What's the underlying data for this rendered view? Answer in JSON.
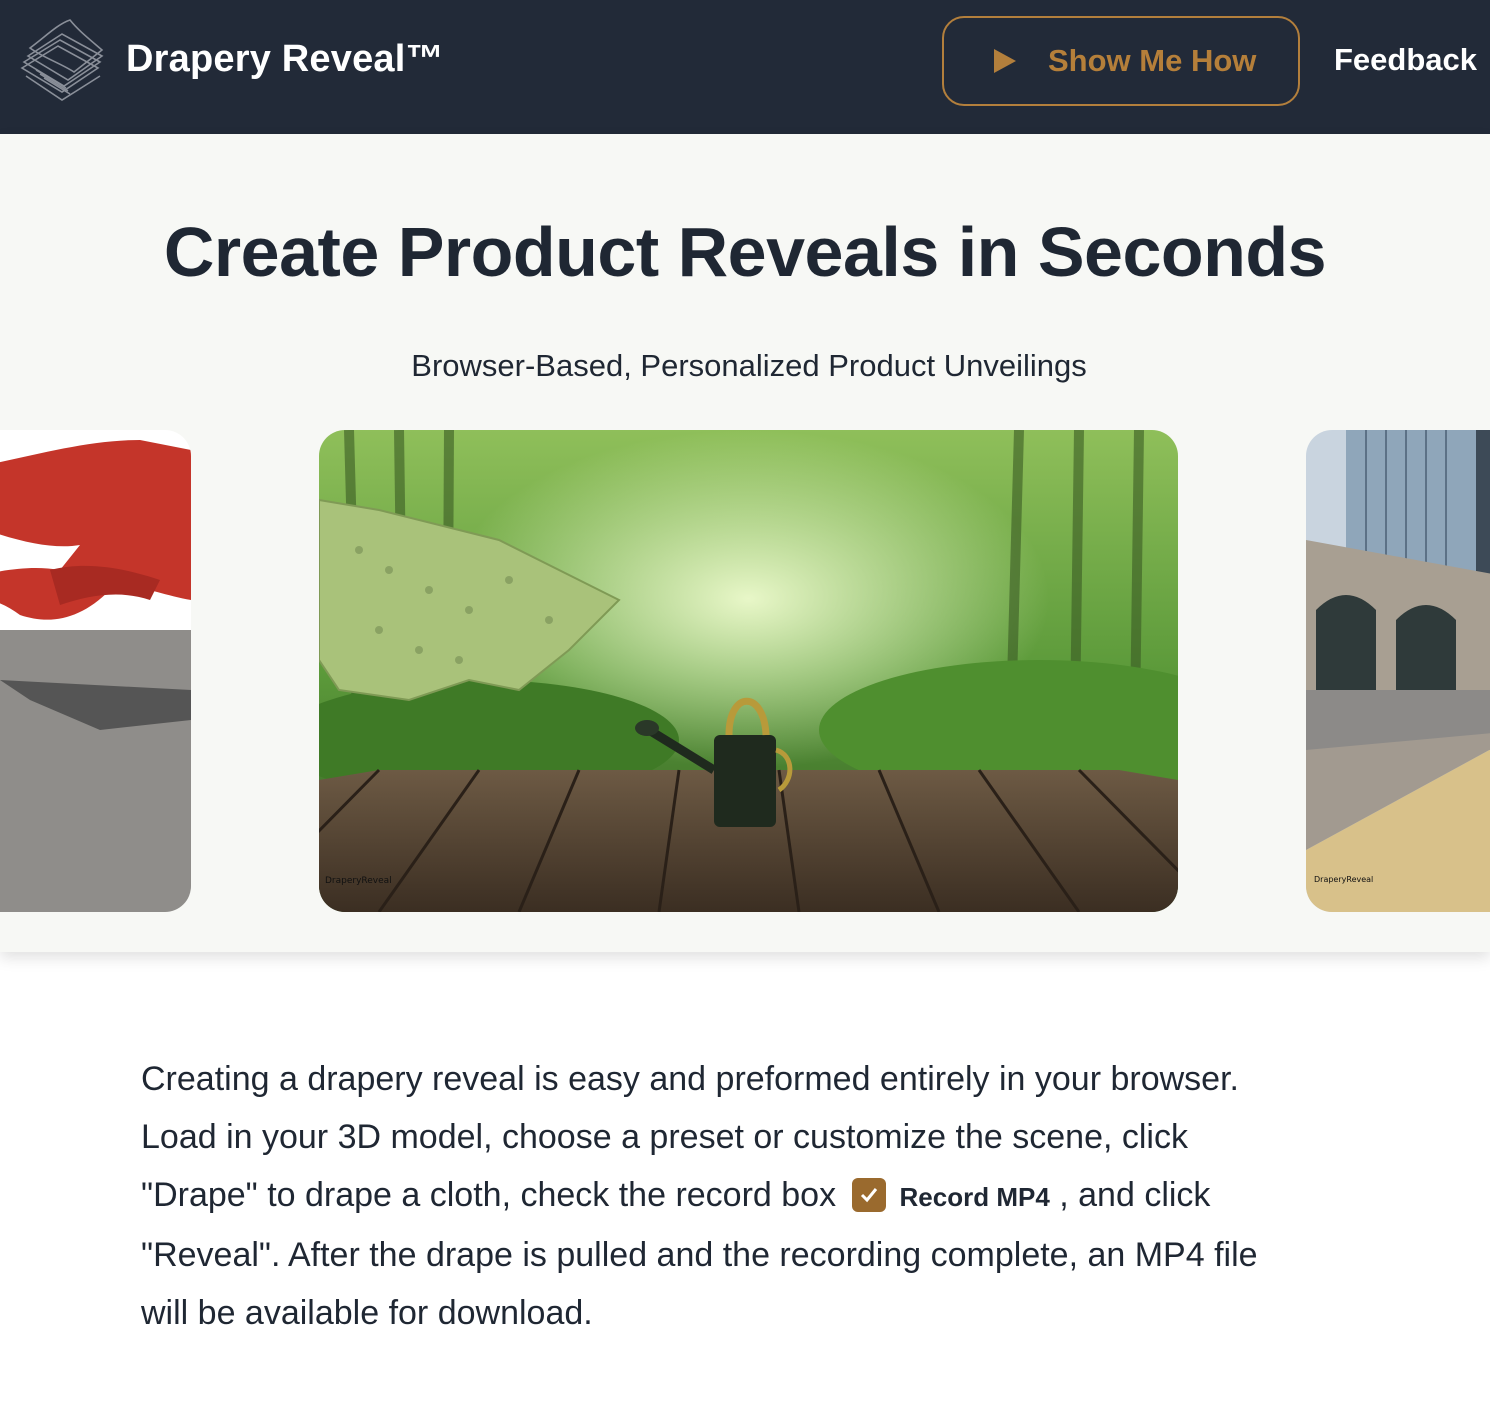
{
  "header": {
    "brand": "Drapery Reveal™",
    "show_me_how": "Show Me How",
    "feedback": "Feedback"
  },
  "hero": {
    "title": "Create Product Reveals in Seconds",
    "subtitle": "Browser-Based, Personalized Product Unveilings",
    "slides": [
      {
        "position": "left",
        "scene": "red cloth on grey floor"
      },
      {
        "position": "center",
        "scene": "watering can on wooden deck in bamboo forest",
        "watermark": "DraperyReveal"
      },
      {
        "position": "right",
        "scene": "city plaza with wooden ground",
        "watermark": "DraperyReveal"
      }
    ]
  },
  "intro": {
    "text_before": "Creating a drapery reveal is easy and preformed entirely in your browser. Load in your 3D model, choose a preset or customize the scene, click \"Drape\" to drape a cloth, check the record box",
    "checkbox_label": "Record MP4",
    "checkbox_checked": true,
    "text_after": ", and click \"Reveal\". After the drape is pulled and the recording complete, an MP4 file will be available for download."
  },
  "colors": {
    "header_bg": "#222a38",
    "accent": "#b37f3c",
    "text": "#1f2733"
  }
}
